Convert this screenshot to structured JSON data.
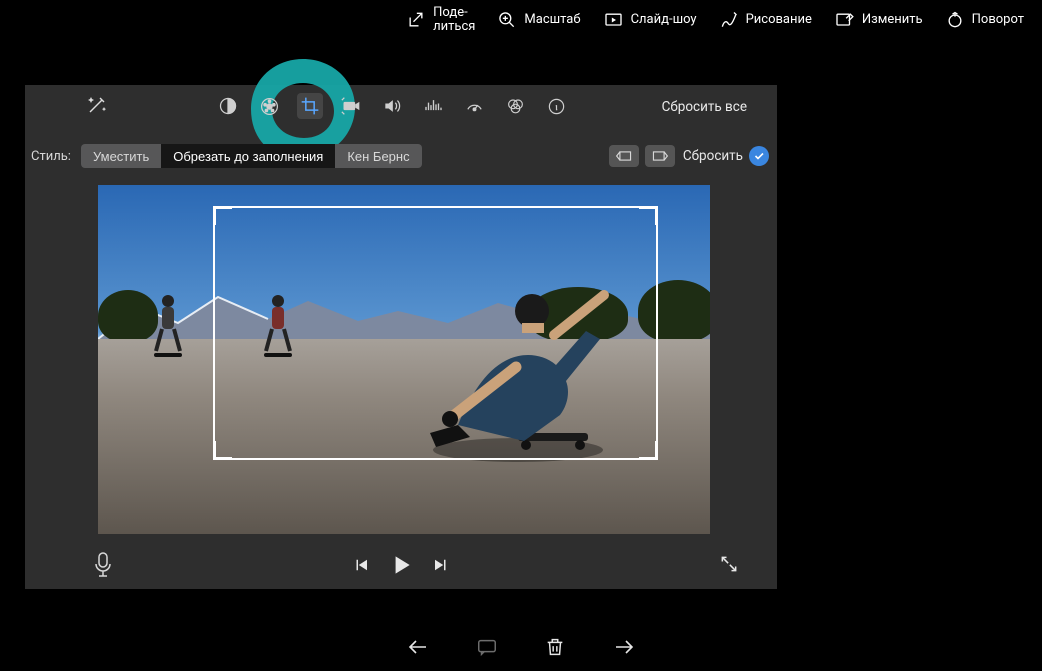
{
  "topbar": {
    "share": "Поде-\nлиться",
    "zoom": "Масштаб",
    "slideshow": "Слайд-шоу",
    "draw": "Рисование",
    "edit": "Изменить",
    "rotate": "Поворот"
  },
  "adjust": {
    "reset_all": "Сбросить все"
  },
  "style": {
    "label": "Стиль:",
    "fit": "Уместить",
    "crop": "Обрезать до заполнения",
    "kenburns": "Кен Бернс",
    "reset": "Сбросить"
  }
}
